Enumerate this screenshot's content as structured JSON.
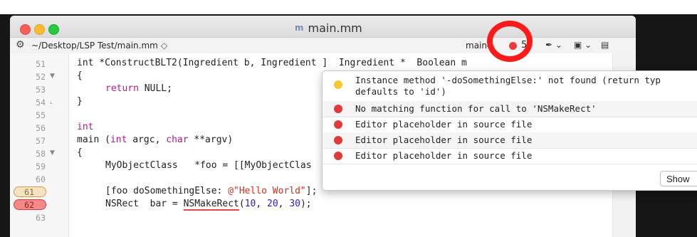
{
  "window": {
    "title": "main.mm",
    "file_icon": "m"
  },
  "jumpbar": {
    "gear_icon": "⚙",
    "path": "~/Desktop/LSP Test/main.mm",
    "path_chevron": "◇",
    "scheme": "main",
    "scheme_chevron": "◇",
    "error_count": "5"
  },
  "gutter": {
    "lines": [
      "51",
      "52",
      "53",
      "54",
      "55",
      "56",
      "57",
      "58",
      "59",
      "60",
      "61",
      "62",
      "63"
    ]
  },
  "code": {
    "l51": "int *ConstructBLT2(Ingredient b, Ingredient ]  Ingredient *  Boolean m",
    "l52": "{",
    "l53_kw": "return",
    "l53_rest": " NULL;",
    "l54": "}",
    "l56_kw": "int",
    "l57_a": "main (",
    "l57_kw1": "int",
    "l57_b": " argc, ",
    "l57_kw2": "char",
    "l57_c": " **argv)",
    "l58": "{",
    "l59": "MyObjectClass   *foo = [[MyObjectClas",
    "l61_a": "[foo doSomethingElse: ",
    "l61_str": "@\"Hello World\"",
    "l61_b": "];",
    "l62_a": "NSRect  bar = ",
    "l62_fn": "NSMakeRect",
    "l62_b": "(",
    "l62_n1": "10",
    "l62_c": ", ",
    "l62_n2": "20",
    "l62_d": ", ",
    "l62_n3": "30",
    "l62_e": ");"
  },
  "issues": [
    {
      "severity": "warning",
      "text": "Instance method '-doSomethingElse:' not found (return typ\ndefaults to 'id')"
    },
    {
      "severity": "error",
      "text": "No matching function for call to 'NSMakeRect'"
    },
    {
      "severity": "error",
      "text": "Editor placeholder in source file"
    },
    {
      "severity": "error",
      "text": "Editor placeholder in source file"
    },
    {
      "severity": "error",
      "text": "Editor placeholder in source file"
    }
  ],
  "popover": {
    "show_button": "Show"
  },
  "colors": {
    "error": "#e03b3b",
    "warning": "#f7c633",
    "annotation_circle": "#ff1a1a"
  }
}
